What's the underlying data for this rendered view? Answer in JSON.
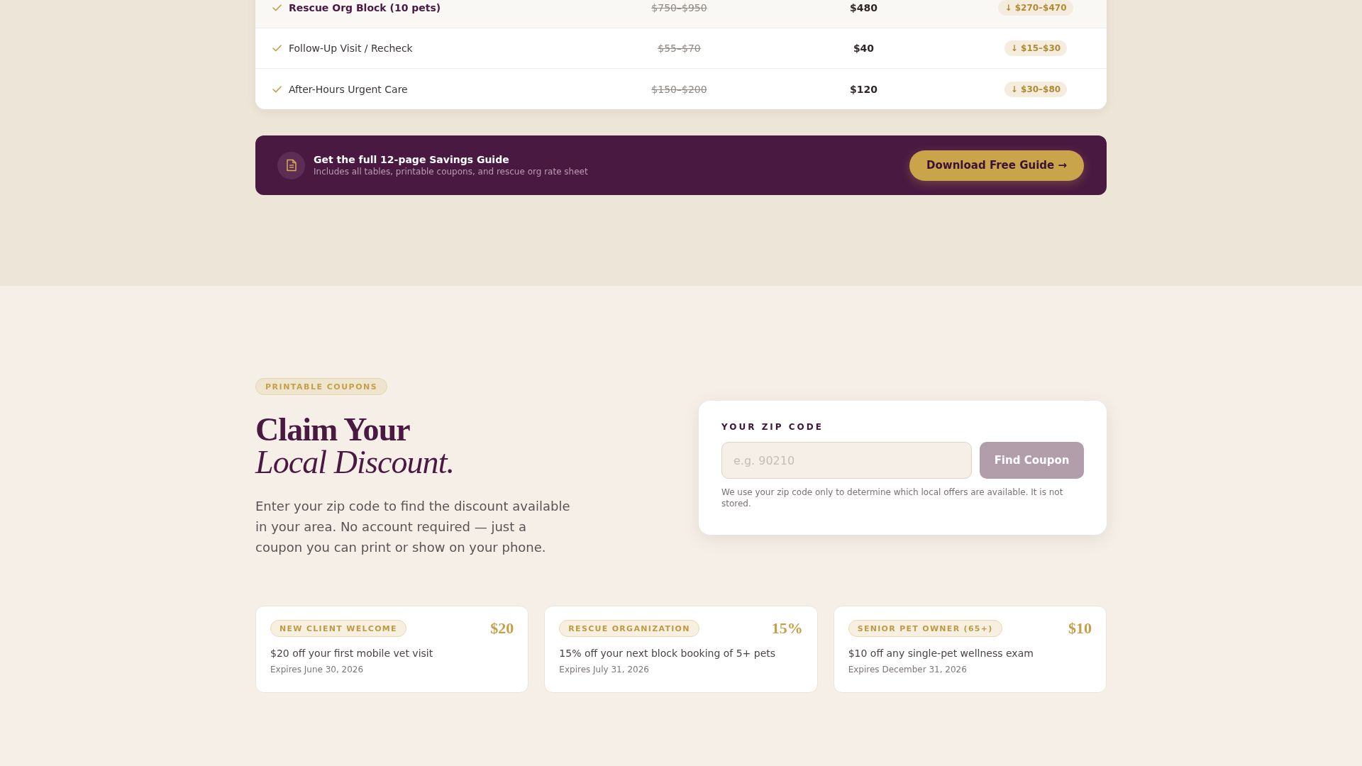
{
  "pricing_table": {
    "rows": [
      {
        "column_1": "Rescue Org Block (10 pets)",
        "column_2": "$750–$950",
        "column_3": "$480",
        "column_4": "↓ $270–$470",
        "highlighted": true
      },
      {
        "column_1": "Follow-Up Visit / Recheck",
        "column_2": "$55–$70",
        "column_3": "$40",
        "column_4": "↓ $15–$30",
        "highlighted": false
      },
      {
        "column_1": "After-Hours Urgent Care",
        "column_2": "$150–$200",
        "column_3": "$120",
        "column_4": "↓ $30–$80",
        "highlighted": false
      }
    ]
  },
  "guide_banner": {
    "title": "Get the full 12-page Savings Guide",
    "subtitle": "Includes all tables, printable coupons, and rescue org rate sheet",
    "button": "Download Free Guide →"
  },
  "coupon_section": {
    "eyebrow": "PRINTABLE COUPONS",
    "heading": "Claim Your *Local Discount.*",
    "intro": "Enter your zip code to find the discount available in your area. No account required — just a coupon you can print or show on your phone."
  },
  "zip_form": {
    "label": "YOUR ZIP CODE",
    "placeholder": "e.g. 90210",
    "button": {
      "label": "Find Coupon",
      "disabled": true
    },
    "note": "We use your zip code only to determine which local offers are available. It is not stored."
  },
  "coupons": [
    {
      "tag": "NEW CLIENT WELCOME",
      "amount": "$20",
      "description": "$20 off your first mobile vet visit",
      "expires": "Expires June 30, 2026"
    },
    {
      "tag": "RESCUE ORGANIZATION",
      "amount": "15%",
      "description": "15% off your next block booking of 5+ pets",
      "expires": "Expires July 31, 2026"
    },
    {
      "tag": "SENIOR PET OWNER (65+)",
      "amount": "$10",
      "description": "$10 off any single-pet wellness exam",
      "expires": "Expires December 31, 2026"
    }
  ]
}
